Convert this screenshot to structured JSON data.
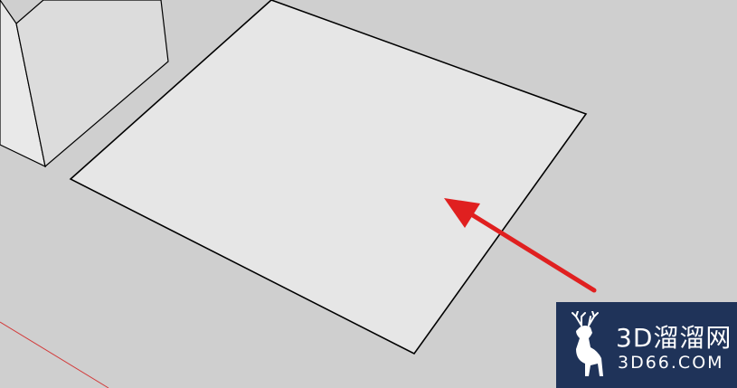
{
  "scene": {
    "background_color": "#cfcfcf",
    "face_color": "#e6e6e6",
    "box_front_color": "#e9e9e9",
    "box_side_color": "#dcdcdc",
    "edge_color": "#000000",
    "axis_color": "#d23a3a",
    "arrow_color": "#e02020"
  },
  "watermark": {
    "title": "3D溜溜网",
    "url": "3D66.COM",
    "background": "#1f3359",
    "logo_icon": "deer-icon"
  }
}
